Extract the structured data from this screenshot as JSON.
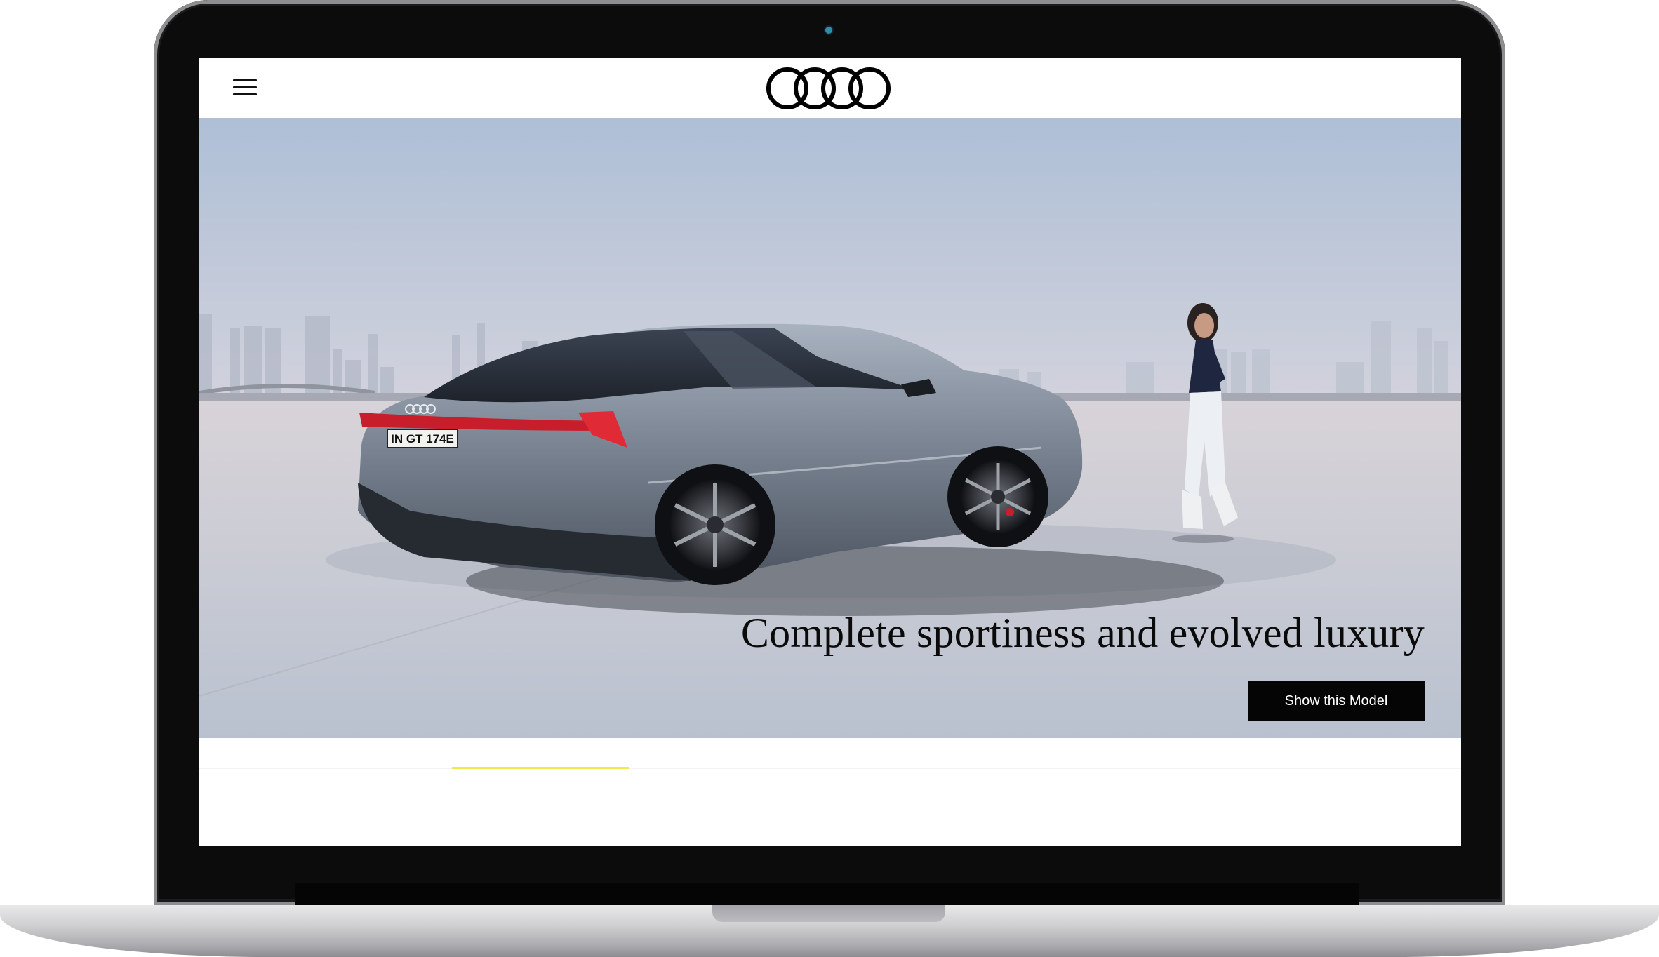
{
  "brand": {
    "logo": "audi-rings-logo"
  },
  "nav": {
    "menu_icon": "hamburger-menu-icon"
  },
  "hero": {
    "headline": "Complete sportiness and evolved luxury",
    "cta_label": "Show this Model",
    "license_plate": "IN GT 174E",
    "image": "audi-e-tron-gt-with-woman-skyline"
  },
  "slider": {
    "progress": 0.14,
    "accent": "#f2e84a"
  },
  "colors": {
    "cta_bg": "#050505",
    "cta_text": "#ffffff",
    "headline": "#0a0a0a"
  }
}
